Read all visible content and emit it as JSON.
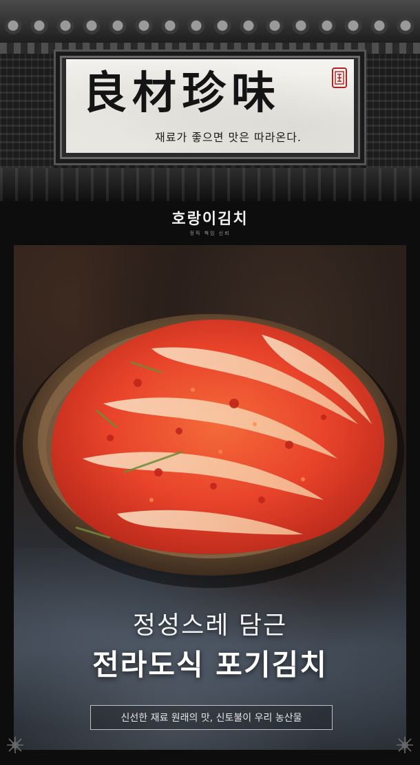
{
  "plaque": {
    "title": "良材珍味",
    "subtitle": "재료가 좋으면 맛은 따라온다."
  },
  "brand": {
    "name": "호랑이김치",
    "tagline": "정직 책임 신뢰"
  },
  "hero": {
    "headline_line1": "정성스레 담근",
    "headline_line2": "전라도식 포기김치",
    "caption": "신선한 재료 원래의 맛, 신토불이 우리 농산물"
  },
  "icons": {
    "seal": "seal-icon",
    "corner_left": "flower-ornament-icon",
    "corner_right": "flower-ornament-icon"
  },
  "colors": {
    "background": "#0d0d0d",
    "kimchi_red": "#e8432a",
    "seal_red": "#b32020"
  }
}
